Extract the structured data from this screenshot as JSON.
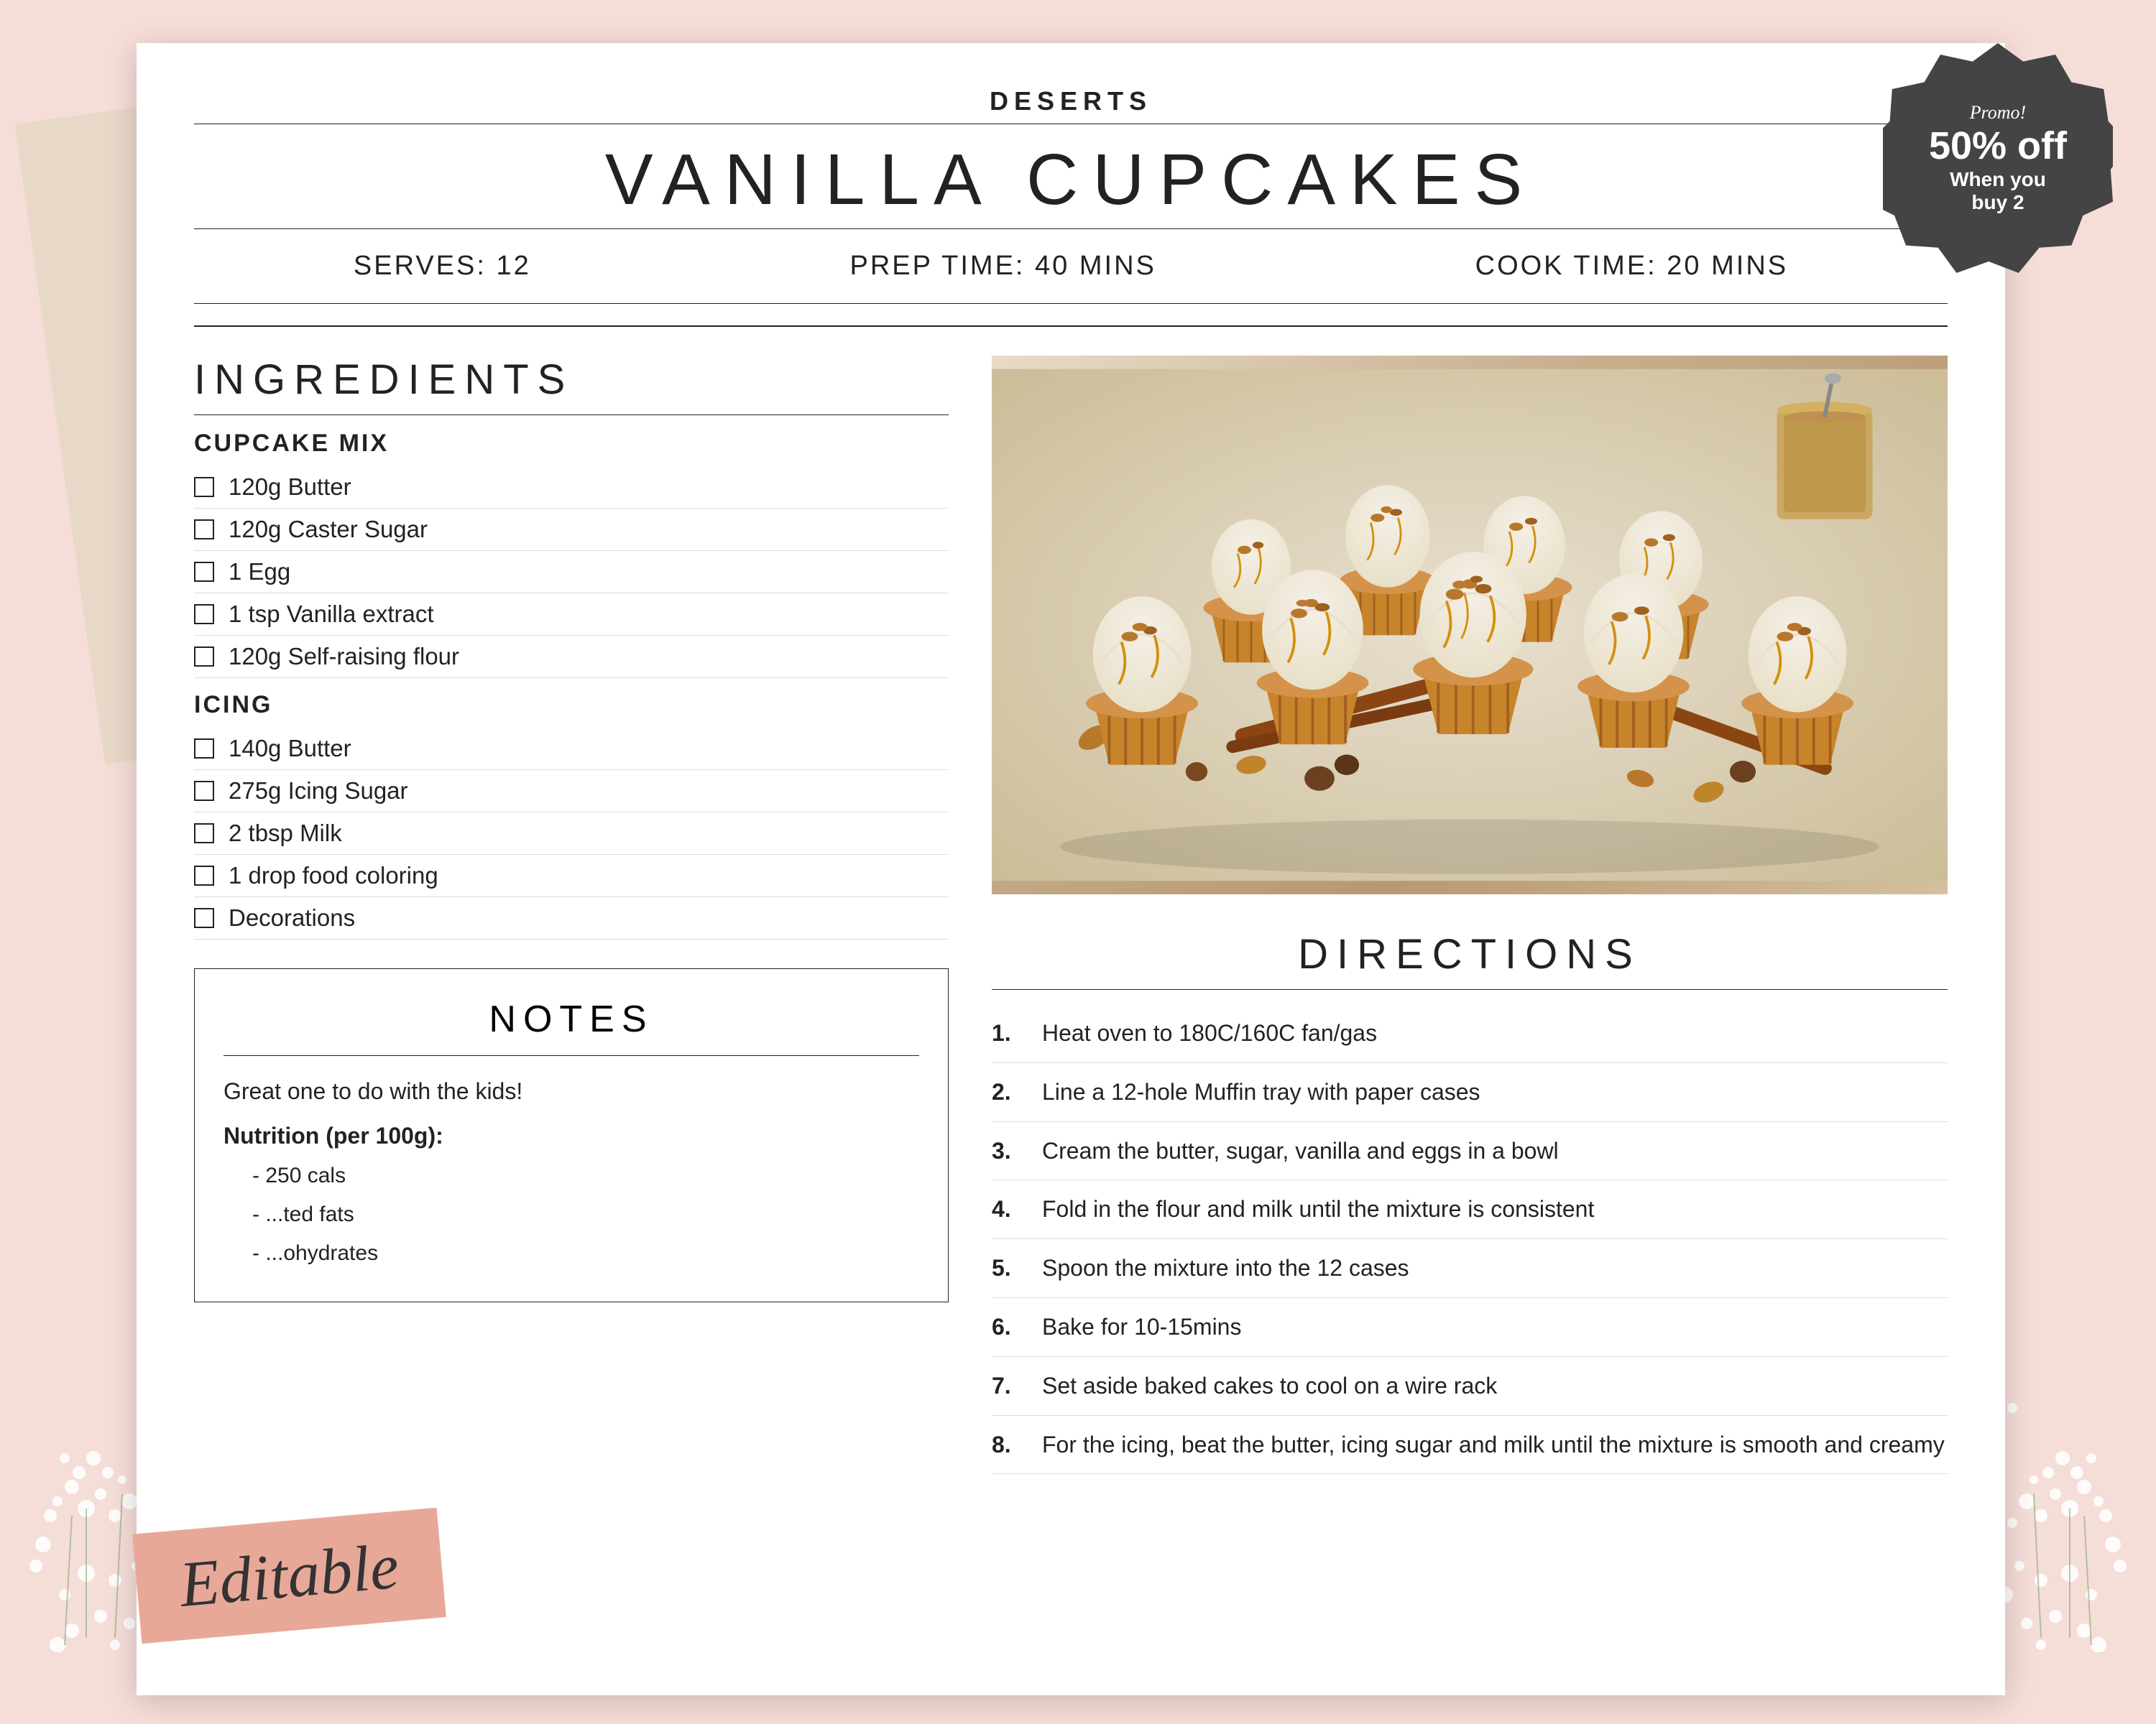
{
  "background": {
    "color": "#f5ddd8"
  },
  "promo": {
    "text": "Promo!",
    "discount": "50% off",
    "line1": "When you",
    "line2": "buy 2"
  },
  "header": {
    "category": "DESERTS",
    "title": "VANILLA CUPCAKES",
    "serves_label": "SERVES: 12",
    "prep_label": "PREP TIME: 40 MINS",
    "cook_label": "COOK TIME: 20 MINS"
  },
  "ingredients": {
    "section_title": "INGREDIENTS",
    "cupcake_mix_label": "CUPCAKE MIX",
    "cupcake_mix_items": [
      "120g Butter",
      "120g Caster Sugar",
      "1 Egg",
      "1 tsp Vanilla extract",
      "120g Self-raising flour"
    ],
    "icing_label": "ICING",
    "icing_items": [
      "140g Butter",
      "275g Icing Sugar",
      "2 tbsp Milk",
      "1 drop food coloring",
      "Decorations"
    ]
  },
  "directions": {
    "section_title": "DIRECTIONS",
    "steps": [
      "Heat oven to 180C/160C fan/gas",
      "Line a 12-hole Muffin tray with paper cases",
      "Cream the butter, sugar, vanilla and eggs in a  bowl",
      "Fold in the flour and milk until the mixture is consistent",
      "Spoon the mixture into the 12 cases",
      "Bake for 10-15mins",
      "Set aside baked cakes to cool on a wire rack",
      "For the icing, beat the butter, icing sugar and milk until the mixture is smooth and creamy"
    ]
  },
  "notes": {
    "section_title": "NOTES",
    "note_text": "Great one to do with the kids!",
    "nutrition_label": "Nutrition (per 100g):",
    "nutrition_items": [
      "- 250 cals",
      "- ...ted fats",
      "- ...ohydrates"
    ]
  },
  "editable": {
    "label": "Editable"
  }
}
